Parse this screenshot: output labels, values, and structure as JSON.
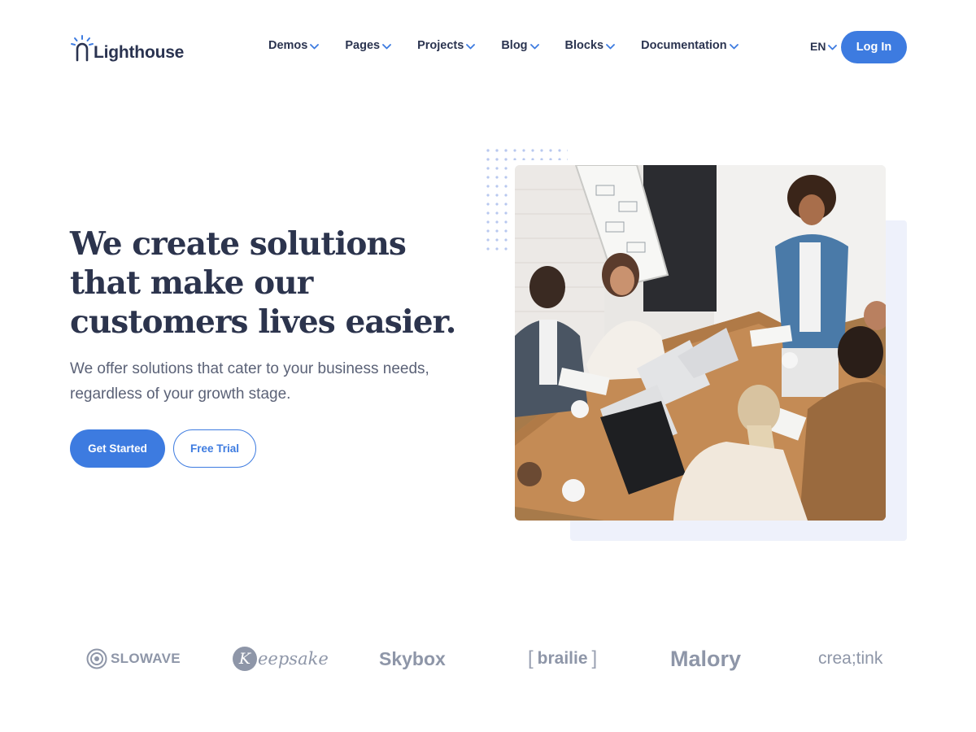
{
  "brand": {
    "name": "Lighthouse",
    "logo_icon": "lighthouse-icon"
  },
  "nav": {
    "items": [
      {
        "label": "Demos"
      },
      {
        "label": "Pages"
      },
      {
        "label": "Projects"
      },
      {
        "label": "Blog"
      },
      {
        "label": "Blocks"
      },
      {
        "label": "Documentation"
      }
    ],
    "language": "EN",
    "login_label": "Log In"
  },
  "hero": {
    "title": "We create solutions that make our customers lives easier.",
    "subtitle": "We offer solutions that cater to your business needs, regardless of your growth stage.",
    "primary_cta": "Get Started",
    "secondary_cta": "Free Trial",
    "image_description": "team-meeting-photo"
  },
  "partners": [
    {
      "name": "SLOWAVE"
    },
    {
      "name": "eepsake",
      "badge": "K"
    },
    {
      "name": "Skybox"
    },
    {
      "name": "brailie"
    },
    {
      "name": "Malory"
    },
    {
      "name": "crea;tink"
    }
  ],
  "colors": {
    "accent": "#3d7be0",
    "heading": "#2c344d",
    "body_text": "#5b6277",
    "panel": "#eef1fb",
    "logo_gray": "#8e96a8"
  }
}
